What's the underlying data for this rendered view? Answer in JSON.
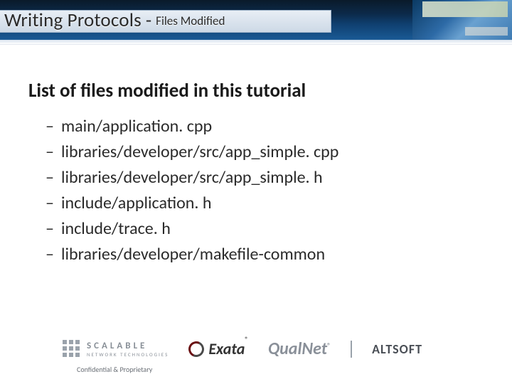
{
  "header": {
    "title_main": "Writing Protocols",
    "title_sep": "-",
    "title_sub": "Files Modified"
  },
  "body": {
    "heading": "List of files modified in this tutorial",
    "files": [
      "main/application. cpp",
      "libraries/developer/src/app_simple. cpp",
      "libraries/developer/src/app_simple. h",
      "include/application. h",
      "include/trace. h",
      "libraries/developer/makefile-common"
    ]
  },
  "footer": {
    "scalable_l1": "SCALABLE",
    "scalable_l2": "NETWORK TECHNOLOGIES",
    "exata": "Exata",
    "qualnet": "QualNet",
    "reg": "®",
    "altsoft": "ALTSOFT",
    "confidential": "Confidential & Proprietary"
  }
}
